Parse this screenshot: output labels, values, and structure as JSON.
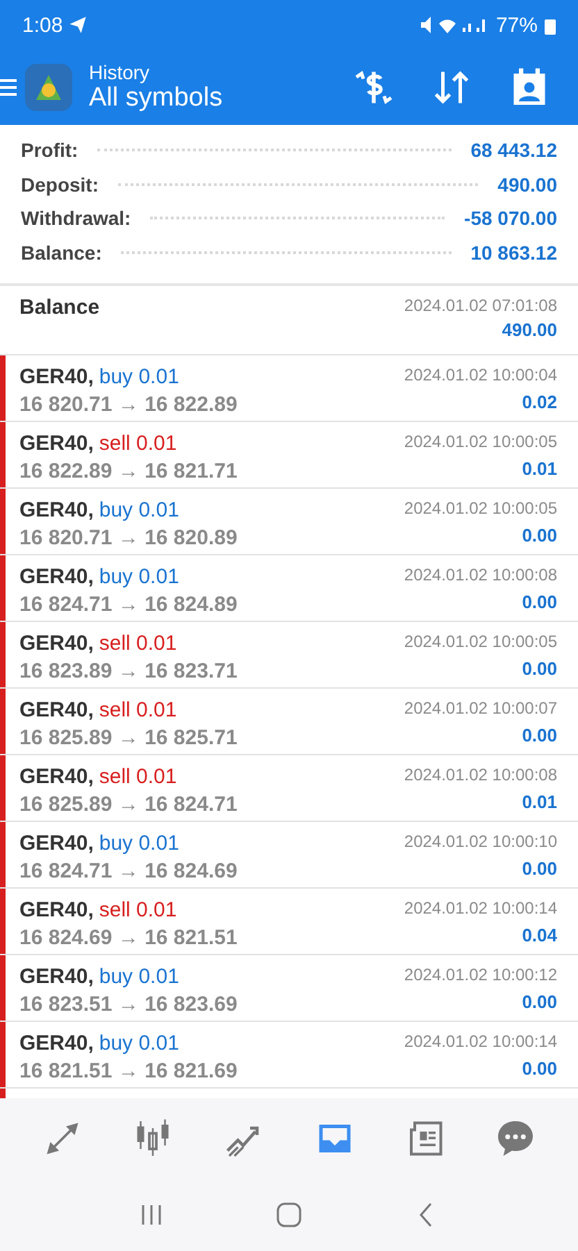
{
  "status_bar": {
    "time": "1:08",
    "battery": "77%"
  },
  "header": {
    "subtitle": "History",
    "title": "All symbols"
  },
  "summary": [
    {
      "label": "Profit:",
      "value": "68 443.12"
    },
    {
      "label": "Deposit:",
      "value": "490.00"
    },
    {
      "label": "Withdrawal:",
      "value": "-58 070.00"
    },
    {
      "label": "Balance:",
      "value": "10 863.12"
    }
  ],
  "balance_entry": {
    "label": "Balance",
    "time": "2024.01.02 07:01:08",
    "amount": "490.00"
  },
  "trades": [
    {
      "symbol": "GER40,",
      "kind": "buy",
      "volume": "buy 0.01",
      "prices": "16 820.71 → 16 822.89",
      "time": "2024.01.02 10:00:04",
      "profit": "0.02"
    },
    {
      "symbol": "GER40,",
      "kind": "sell",
      "volume": "sell 0.01",
      "prices": "16 822.89 → 16 821.71",
      "time": "2024.01.02 10:00:05",
      "profit": "0.01"
    },
    {
      "symbol": "GER40,",
      "kind": "buy",
      "volume": "buy 0.01",
      "prices": "16 820.71 → 16 820.89",
      "time": "2024.01.02 10:00:05",
      "profit": "0.00"
    },
    {
      "symbol": "GER40,",
      "kind": "buy",
      "volume": "buy 0.01",
      "prices": "16 824.71 → 16 824.89",
      "time": "2024.01.02 10:00:08",
      "profit": "0.00"
    },
    {
      "symbol": "GER40,",
      "kind": "sell",
      "volume": "sell 0.01",
      "prices": "16 823.89 → 16 823.71",
      "time": "2024.01.02 10:00:05",
      "profit": "0.00"
    },
    {
      "symbol": "GER40,",
      "kind": "sell",
      "volume": "sell 0.01",
      "prices": "16 825.89 → 16 825.71",
      "time": "2024.01.02 10:00:07",
      "profit": "0.00"
    },
    {
      "symbol": "GER40,",
      "kind": "sell",
      "volume": "sell 0.01",
      "prices": "16 825.89 → 16 824.71",
      "time": "2024.01.02 10:00:08",
      "profit": "0.01"
    },
    {
      "symbol": "GER40,",
      "kind": "buy",
      "volume": "buy 0.01",
      "prices": "16 824.71 → 16 824.69",
      "time": "2024.01.02 10:00:10",
      "profit": "0.00"
    },
    {
      "symbol": "GER40,",
      "kind": "sell",
      "volume": "sell 0.01",
      "prices": "16 824.69 → 16 821.51",
      "time": "2024.01.02 10:00:14",
      "profit": "0.04"
    },
    {
      "symbol": "GER40,",
      "kind": "buy",
      "volume": "buy 0.01",
      "prices": "16 823.51 → 16 823.69",
      "time": "2024.01.02 10:00:12",
      "profit": "0.00"
    },
    {
      "symbol": "GER40,",
      "kind": "buy",
      "volume": "buy 0.01",
      "prices": "16 821.51 → 16 821.69",
      "time": "2024.01.02 10:00:14",
      "profit": "0.00"
    }
  ],
  "bottom_nav": [
    {
      "kind": "quotes",
      "selected": false
    },
    {
      "kind": "chart",
      "selected": false
    },
    {
      "kind": "trade",
      "selected": false
    },
    {
      "kind": "history",
      "selected": true
    },
    {
      "kind": "news",
      "selected": false
    },
    {
      "kind": "chat",
      "selected": false
    }
  ]
}
